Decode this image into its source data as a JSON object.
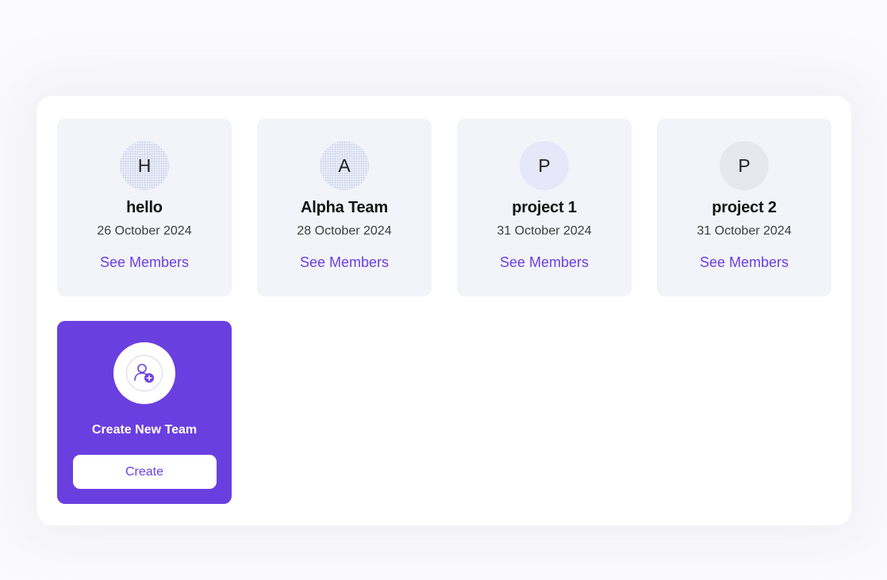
{
  "teams": [
    {
      "initial": "H",
      "name": "hello",
      "date": "26 October 2024",
      "link_label": "See Members"
    },
    {
      "initial": "A",
      "name": "Alpha Team",
      "date": "28 October 2024",
      "link_label": "See Members"
    },
    {
      "initial": "P",
      "name": "project 1",
      "date": "31 October 2024",
      "link_label": "See Members"
    },
    {
      "initial": "P",
      "name": "project 2",
      "date": "31 October 2024",
      "link_label": "See Members"
    }
  ],
  "create_card": {
    "icon": "add-user-icon",
    "title": "Create New Team",
    "button_label": "Create"
  },
  "colors": {
    "accent": "#6a3fe0",
    "card_bg": "#f3f4f9",
    "panel_bg": "#ffffff"
  }
}
